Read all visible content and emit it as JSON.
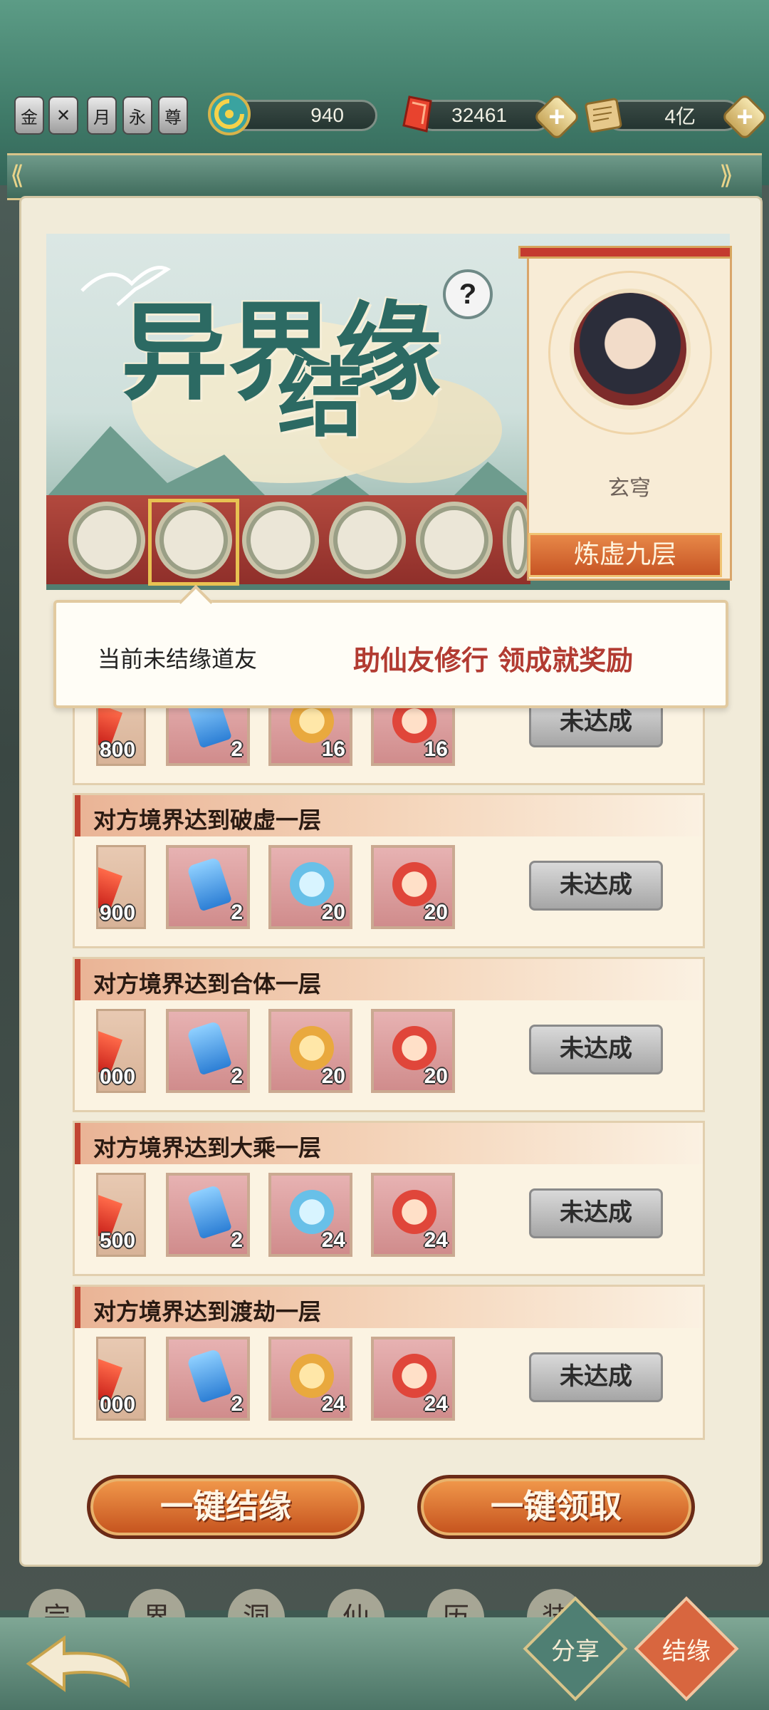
{
  "topbar": {
    "badges": [
      "金",
      "✕",
      "月",
      "永",
      "尊"
    ],
    "resources": [
      {
        "name": "spirit-stone",
        "value": "940",
        "has_plus": false
      },
      {
        "name": "red-crystal",
        "value": "32461",
        "has_plus": true
      },
      {
        "name": "scroll",
        "value": "4亿",
        "has_plus": true
      }
    ]
  },
  "banner": {
    "title_line1": "异界缘",
    "title_line2": "结",
    "help": "?"
  },
  "partner": {
    "name": "玄穹",
    "realm": "炼虚九层"
  },
  "speech": {
    "left": "当前未结缘道友",
    "right": "助仙友修行 领成就奖励"
  },
  "tasks": [
    {
      "title": "",
      "first_count": "800",
      "jade": "2",
      "gourd1": "16",
      "gourd2": "16",
      "status": "未达成"
    },
    {
      "title": "对方境界达到破虚一层",
      "first_count": "900",
      "jade": "2",
      "gourd1": "20",
      "gourd2": "20",
      "status": "未达成"
    },
    {
      "title": "对方境界达到合体一层",
      "first_count": "000",
      "jade": "2",
      "gourd1": "20",
      "gourd2": "20",
      "status": "未达成"
    },
    {
      "title": "对方境界达到大乘一层",
      "first_count": "500",
      "jade": "2",
      "gourd1": "24",
      "gourd2": "24",
      "status": "未达成"
    },
    {
      "title": "对方境界达到渡劫一层",
      "first_count": "000",
      "jade": "2",
      "gourd1": "24",
      "gourd2": "24",
      "status": "未达成"
    }
  ],
  "buttons": {
    "one_click_bond": "一键结缘",
    "one_click_claim": "一键领取"
  },
  "nav": {
    "tabs": [
      "宗",
      "界",
      "洞",
      "仙",
      "历",
      "装"
    ],
    "share": "分享",
    "bond": "结缘"
  },
  "colors": {
    "accent_red": "#b23b32",
    "button_orange": "#e07a35",
    "teal": "#2c6a63"
  }
}
